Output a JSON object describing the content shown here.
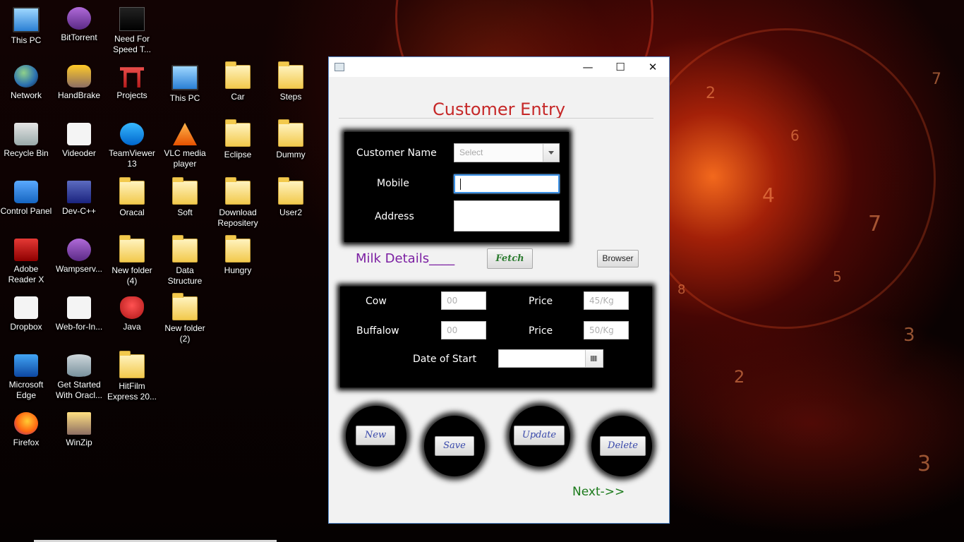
{
  "desktop": {
    "icons": [
      {
        "label": "This PC",
        "icon": "computer-icon"
      },
      {
        "label": "BitTorrent",
        "icon": "bittorrent-icon"
      },
      {
        "label": "Need For Speed T...",
        "icon": "game-icon"
      },
      {
        "label": "Network",
        "icon": "network-globe-icon"
      },
      {
        "label": "HandBrake",
        "icon": "handbrake-icon"
      },
      {
        "label": "Projects",
        "icon": "torii-icon"
      },
      {
        "label": "This PC",
        "icon": "computer-shortcut-icon"
      },
      {
        "label": "Car",
        "icon": "folder-icon"
      },
      {
        "label": "Steps",
        "icon": "folder-icon"
      },
      {
        "label": "Recycle Bin",
        "icon": "recycle-bin-icon"
      },
      {
        "label": "Videoder",
        "icon": "videoder-icon"
      },
      {
        "label": "TeamViewer 13",
        "icon": "teamviewer-icon"
      },
      {
        "label": "VLC media player",
        "icon": "vlc-icon"
      },
      {
        "label": "Eclipse",
        "icon": "folder-icon"
      },
      {
        "label": "Dummy",
        "icon": "folder-icon"
      },
      {
        "label": "Control Panel",
        "icon": "control-panel-icon"
      },
      {
        "label": "Dev-C++",
        "icon": "devcpp-icon"
      },
      {
        "label": "Oracal",
        "icon": "folder-icon"
      },
      {
        "label": "Soft",
        "icon": "folder-icon"
      },
      {
        "label": "Download Repositery",
        "icon": "folder-icon"
      },
      {
        "label": "User2",
        "icon": "folder-icon"
      },
      {
        "label": "Adobe Reader X",
        "icon": "adobe-reader-icon"
      },
      {
        "label": "Wampserv...",
        "icon": "wampserver-icon"
      },
      {
        "label": "New folder (4)",
        "icon": "folder-icon"
      },
      {
        "label": "Data Structure",
        "icon": "folder-icon"
      },
      {
        "label": "Hungry",
        "icon": "folder-icon"
      },
      {
        "label": "Dropbox",
        "icon": "dropbox-icon"
      },
      {
        "label": "Web-for-In...",
        "icon": "web-icon"
      },
      {
        "label": "Java",
        "icon": "java-icon"
      },
      {
        "label": "New folder (2)",
        "icon": "folder-icon"
      },
      {
        "label": "Microsoft Edge",
        "icon": "edge-icon"
      },
      {
        "label": "Get Started With Oracl...",
        "icon": "database-icon"
      },
      {
        "label": "HitFilm Express 20...",
        "icon": "folder-icon"
      },
      {
        "label": "Firefox",
        "icon": "firefox-icon"
      },
      {
        "label": "WinZip",
        "icon": "winzip-icon"
      }
    ]
  },
  "window": {
    "controls": {
      "minimize": "—",
      "maximize": "☐",
      "close": "✕"
    },
    "title": "Customer Entry",
    "customer": {
      "name_label": "Customer Name",
      "name_placeholder": "Select",
      "mobile_label": "Mobile",
      "mobile_value": "",
      "address_label": "Address",
      "address_value": ""
    },
    "milk_section": "Milk Details____",
    "fetch_label": "Fetch",
    "browser_label": "Browser",
    "milk": {
      "cow_label": "Cow",
      "cow_placeholder": "00",
      "cow_price_label": "Price",
      "cow_price_placeholder": "45/Kg",
      "buffalo_label": "Buffalow",
      "buffalo_placeholder": "00",
      "buffalo_price_label": "Price",
      "buffalo_price_placeholder": "50/Kg",
      "date_label": "Date of Start",
      "date_value": ""
    },
    "actions": {
      "new": "New",
      "save": "Save",
      "update": "Update",
      "delete": "Delete"
    },
    "next_label": "Next->>",
    "colors": {
      "title": "#c62828",
      "section": "#7b1fa2",
      "fetch": "#2e7d32",
      "action_text": "#3949ab",
      "next": "#1b7a1b",
      "focus": "#3c91e6"
    }
  }
}
